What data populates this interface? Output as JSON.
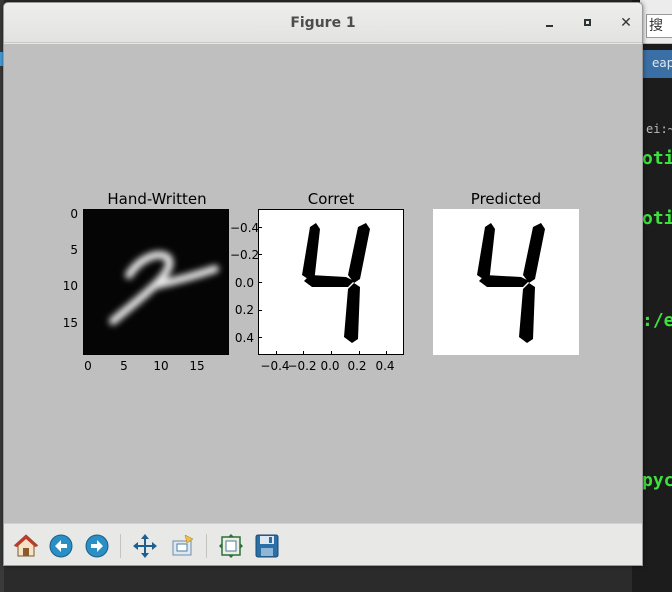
{
  "window": {
    "title": "Figure 1"
  },
  "background_terminal": {
    "search_text": "搜",
    "tab_text": "eapt",
    "path_text": "ei:~",
    "lines": [
      "oti",
      "oti",
      ":/e",
      "pyc"
    ]
  },
  "figure": {
    "panels": [
      {
        "title": "Hand-Written",
        "yticks": [
          "0",
          "5",
          "10",
          "15"
        ],
        "xticks": [
          "0",
          "5",
          "10",
          "15"
        ],
        "image": "grayscale handwritten digit on black background"
      },
      {
        "title": "Corret",
        "yticks": [
          "−0.4",
          "−0.2",
          "0.0",
          "0.2",
          "0.4"
        ],
        "xticks": [
          "−0.4",
          "−0.2",
          "0.0",
          "0.2",
          "0.4"
        ],
        "image": "seven-segment style digit 4"
      },
      {
        "title": "Predicted",
        "image": "seven-segment style digit 4"
      }
    ]
  },
  "toolbar": {
    "buttons": [
      {
        "name": "home-icon",
        "label": "Home"
      },
      {
        "name": "back-icon",
        "label": "Back"
      },
      {
        "name": "forward-icon",
        "label": "Forward"
      },
      {
        "name": "pan-icon",
        "label": "Pan"
      },
      {
        "name": "zoom-icon",
        "label": "Zoom"
      },
      {
        "name": "subplots-icon",
        "label": "Subplots"
      },
      {
        "name": "save-icon",
        "label": "Save"
      }
    ]
  },
  "colors": {
    "canvas_bg": "#bfbfbf",
    "window_bg": "#e8e8e7",
    "terminal_green": "#3ce23c"
  }
}
